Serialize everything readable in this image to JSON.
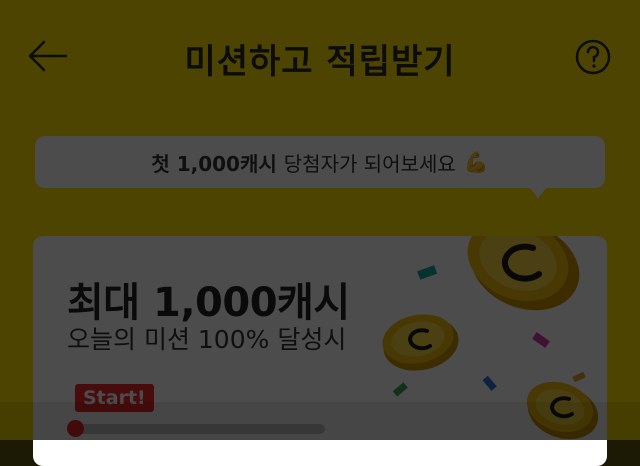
{
  "header": {
    "title": "미션하고 적립받기",
    "back_icon": "arrow-left-icon",
    "help_icon": "question-circle-icon"
  },
  "banner": {
    "highlight": "첫 1,000캐시",
    "text": "당첨자가 되어보세요",
    "emoji": "💪"
  },
  "card": {
    "title": "최대 1,000캐시",
    "subtitle": "오늘의 미션 100% 달성시",
    "start_label": "Start!",
    "progress": 0
  },
  "colors": {
    "background": "#ffe300",
    "accent_red": "#f02a2a",
    "coin_gold": "#f2c010"
  }
}
